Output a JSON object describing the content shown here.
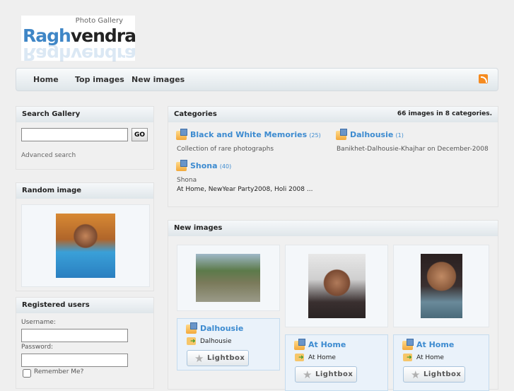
{
  "logo": {
    "subtitle": "Photo Gallery",
    "name_a": "Ragh",
    "name_b": "vendra"
  },
  "nav": {
    "items": [
      "Home",
      "Top images",
      "New images"
    ]
  },
  "search": {
    "title": "Search Gallery",
    "go": "GO",
    "advanced": "Advanced search",
    "value": ""
  },
  "random": {
    "title": "Random image"
  },
  "users": {
    "title": "Registered users",
    "username_label": "Username:",
    "password_label": "Password:",
    "remember": "Remember Me?"
  },
  "categories": {
    "title": "Categories",
    "summary": "66 images in 8 categories.",
    "items": [
      {
        "name": "Black and White Memories",
        "count": "(25)",
        "desc": "Collection of rare photographs"
      },
      {
        "name": "Dalhousie",
        "count": "(1)",
        "desc": "Banikhet-Dalhousie-Khajhar on December-2008"
      },
      {
        "name": "Shona",
        "count": "(40)",
        "desc": "Shona",
        "subcats": "At Home, NewYear Party2008, Holi 2008 ..."
      }
    ]
  },
  "new_images": {
    "title": "New images",
    "items": [
      {
        "title": "Dalhousie",
        "category": "Dalhousie",
        "button": "Lightbox"
      },
      {
        "title": "At Home",
        "category": "At Home",
        "button": "Lightbox"
      },
      {
        "title": "At Home",
        "category": "At Home",
        "button": "Lightbox"
      }
    ]
  }
}
